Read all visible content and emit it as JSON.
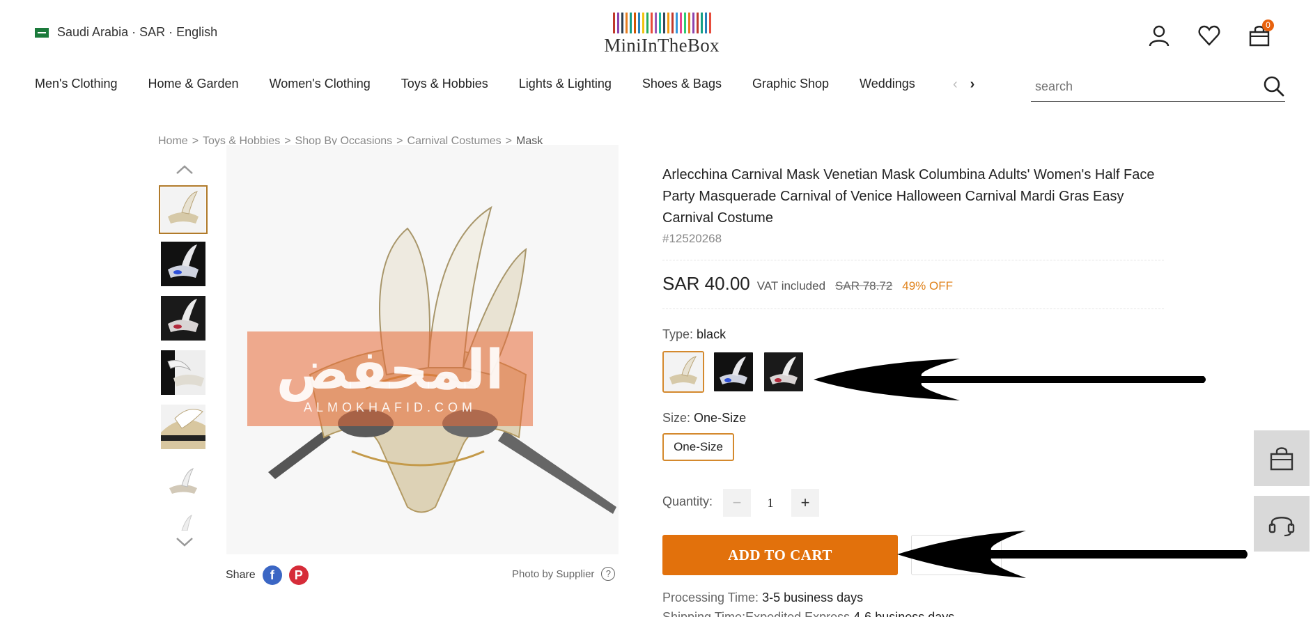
{
  "header": {
    "region": "Saudi Arabia · SAR · English",
    "logo_text": "MiniInTheBox",
    "cart_count": "0"
  },
  "nav": {
    "items": [
      "Men's Clothing",
      "Home & Garden",
      "Women's Clothing",
      "Toys & Hobbies",
      "Lights & Lighting",
      "Shoes & Bags",
      "Graphic Shop",
      "Weddings"
    ],
    "search_placeholder": "search"
  },
  "breadcrumb": [
    "Home",
    "Toys & Hobbies",
    "Shop By Occasions",
    "Carnival Costumes",
    "Mask"
  ],
  "gallery": {
    "watermark_arabic": "المحفض",
    "watermark_sub": "ALMOKHAFID.COM",
    "share_label": "Share",
    "supplier_label": "Photo by Supplier"
  },
  "product": {
    "title": "Arlecchina Carnival Mask Venetian Mask Columbina Adults' Women's Half Face Party Masquerade Carnival of Venice Halloween Carnival Mardi Gras Easy Carnival Costume",
    "sku": "#12520268",
    "price": "SAR 40.00",
    "vat": "VAT included",
    "old_price": "SAR 78.72",
    "discount": "49% OFF",
    "type_label": "Type:",
    "type_value": "black",
    "size_label": "Size:",
    "size_value": "One-Size",
    "size_option": "One-Size",
    "qty_label": "Quantity:",
    "qty_value": "1",
    "add_to_cart": "ADD TO CART",
    "processing_label": "Processing Time:",
    "processing_value": "3-5 business days",
    "shipping_label": "Shipping Time:Expedited Express",
    "shipping_value": "4-6 business days"
  },
  "colors": {
    "accent": "#e2710c",
    "discount": "#e0821b",
    "selected_border": "#d4892d"
  }
}
